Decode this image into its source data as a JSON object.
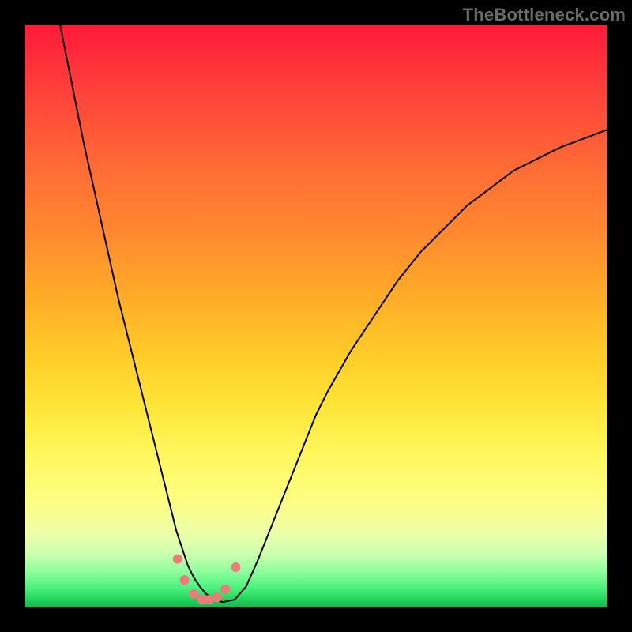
{
  "watermark": "TheBottleneck.com",
  "chart_data": {
    "type": "line",
    "title": "",
    "xlabel": "",
    "ylabel": "",
    "xlim": [
      0,
      100
    ],
    "ylim": [
      0,
      100
    ],
    "grid": false,
    "series": [
      {
        "name": "bottleneck-curve",
        "color": "#000000",
        "x": [
          6,
          8,
          10,
          12,
          14,
          16,
          18,
          20,
          22,
          23,
          24,
          25,
          26,
          27,
          28,
          29,
          30,
          31,
          32,
          33,
          34,
          36,
          38,
          40,
          42,
          44,
          46,
          48,
          50,
          52,
          56,
          60,
          64,
          68,
          72,
          76,
          80,
          84,
          88,
          92,
          96,
          100
        ],
        "y": [
          100,
          90,
          80,
          71,
          62,
          53,
          45,
          37,
          29,
          25,
          21,
          17,
          13,
          10,
          7,
          5,
          3.5,
          2.3,
          1.5,
          1.0,
          0.8,
          1.2,
          3.5,
          8,
          13,
          18,
          23,
          28,
          33,
          37,
          44,
          50,
          56,
          61,
          65,
          69,
          72,
          75,
          77,
          79,
          80.5,
          82
        ]
      }
    ],
    "markers": {
      "name": "bottom-cluster",
      "color": "#ef7a7a",
      "points": [
        {
          "x": 26.2,
          "y": 8.2
        },
        {
          "x": 27.4,
          "y": 4.6
        },
        {
          "x": 29.0,
          "y": 2.2
        },
        {
          "x": 30.4,
          "y": 1.2
        },
        {
          "x": 31.6,
          "y": 1.2
        },
        {
          "x": 33.0,
          "y": 1.6
        },
        {
          "x": 34.4,
          "y": 3.0
        },
        {
          "x": 36.2,
          "y": 6.8
        }
      ],
      "radius_px": 6
    },
    "background_gradient": {
      "top": "#ff1a3a",
      "mid_upper": "#ff8a2e",
      "mid_lower": "#ffe63a",
      "bottom": "#17b84e"
    }
  }
}
